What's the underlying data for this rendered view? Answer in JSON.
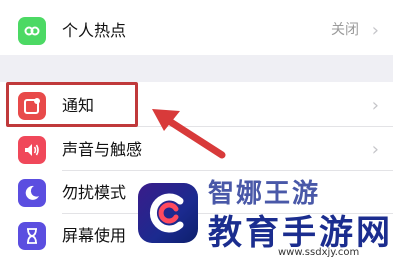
{
  "settings": {
    "items": [
      {
        "label": "个人热点",
        "value": "关闭",
        "icon": "personal-hotspot-icon",
        "color": "#4cd964"
      },
      {
        "label": "通知",
        "icon": "notifications-icon",
        "color": "#e84a4a"
      },
      {
        "label": "声音与触感",
        "icon": "speaker-icon",
        "color": "#f0485a"
      },
      {
        "label": "勿扰模式",
        "icon": "moon-icon",
        "color": "#5b4ee0"
      },
      {
        "label": "屏幕使用",
        "icon": "hourglass-icon",
        "color": "#5b4ee0"
      }
    ],
    "chevron": "›"
  },
  "watermark": {
    "title_top": "智娜王游",
    "title": "教育手游网",
    "url": "www.ssdxjy.com"
  },
  "colors": {
    "highlight": "#c0393b",
    "accent": "#1b2d8f"
  }
}
